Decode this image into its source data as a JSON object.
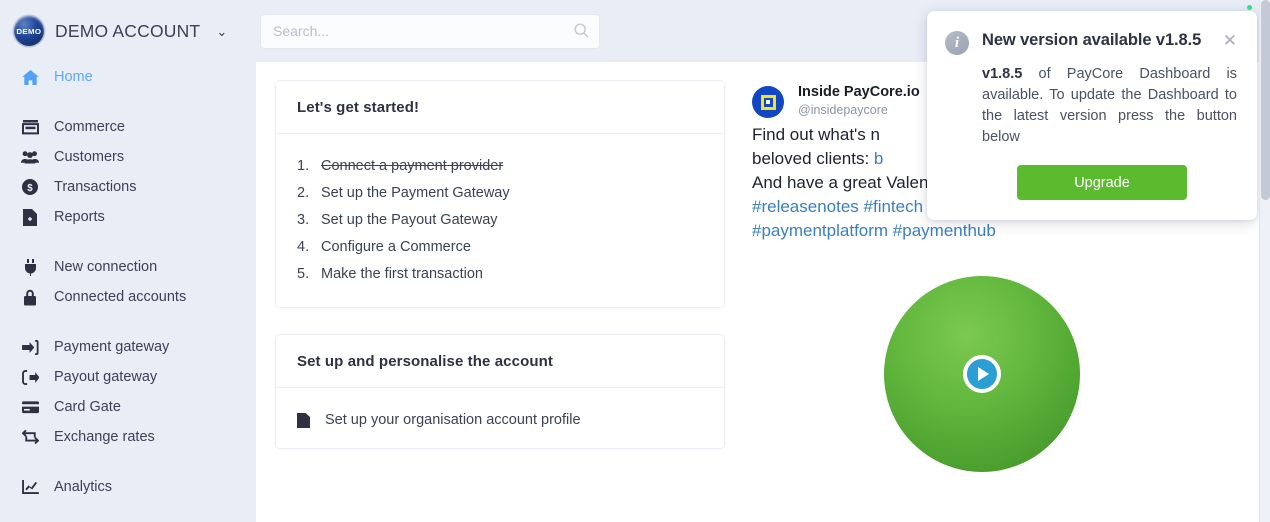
{
  "sidebar": {
    "brand": {
      "logo_text": "DEMO",
      "name": "DEMO ACCOUNT",
      "caret": "⌄"
    },
    "groups": [
      {
        "items": [
          {
            "label": "Home",
            "icon": "home-icon",
            "active": true
          }
        ]
      },
      {
        "items": [
          {
            "label": "Commerce",
            "icon": "store-icon",
            "active": false
          },
          {
            "label": "Customers",
            "icon": "users-icon",
            "active": false
          },
          {
            "label": "Transactions",
            "icon": "dollar-circle-icon",
            "active": false
          },
          {
            "label": "Reports",
            "icon": "report-file-icon",
            "active": false
          }
        ]
      },
      {
        "items": [
          {
            "label": "New connection",
            "icon": "plug-icon",
            "active": false
          },
          {
            "label": "Connected accounts",
            "icon": "lock-icon",
            "active": false
          }
        ]
      },
      {
        "items": [
          {
            "label": "Payment gateway",
            "icon": "sign-in-icon",
            "active": false
          },
          {
            "label": "Payout gateway",
            "icon": "sign-out-icon",
            "active": false
          },
          {
            "label": "Card Gate",
            "icon": "credit-card-icon",
            "active": false
          },
          {
            "label": "Exchange rates",
            "icon": "exchange-icon",
            "active": false
          }
        ]
      },
      {
        "items": [
          {
            "label": "Analytics",
            "icon": "chart-line-icon",
            "active": false
          }
        ]
      }
    ]
  },
  "topbar": {
    "search": {
      "value": "",
      "placeholder": "Search...",
      "icon": "search-icon"
    }
  },
  "get_started_card": {
    "title": "Let's get started!",
    "steps": [
      {
        "text": "Connect a payment provider",
        "done": true
      },
      {
        "text": "Set up the Payment Gateway",
        "done": false
      },
      {
        "text": "Set up the Payout Gateway",
        "done": false
      },
      {
        "text": "Configure a Commerce",
        "done": false
      },
      {
        "text": "Make the first transaction",
        "done": false
      }
    ]
  },
  "account_card": {
    "title": "Set up and personalise the account",
    "first_row": {
      "icon": "profile-file-icon",
      "label": "Set up your organisation account profile"
    }
  },
  "feed": {
    "author_name": "Inside PayCore.io",
    "author_handle": "@insidepaycore",
    "avatar_icon": "paycore-avatar-icon",
    "text_line1": "Find out what's n",
    "text_line2_prefix": "beloved clients: ",
    "text_line2_link": "b",
    "text_line3": "And have a great Valentine's weekend!",
    "hashtags_line1": "#releasenotes #fintech #payments",
    "hashtags_line2": "#paymentplatform #paymenthub",
    "media": {
      "type": "video-thumbnail",
      "play_icon": "play-icon"
    }
  },
  "toast": {
    "icon": "info-icon",
    "title": "New version available v1.8.5",
    "close_icon": "close-icon",
    "message_version": "v1.8.5",
    "message_rest": " of PayCore Dashboard is available. To update the Dashboard to the latest version press the button below",
    "button_label": "Upgrade",
    "accent_color": "#5cba2e"
  },
  "colors": {
    "sidebar_bg": "#e9edf6",
    "accent_blue": "#51a2f5",
    "link_blue": "#3a7fbf",
    "text_dark": "#2e3243",
    "upgrade_green": "#5cba2e"
  }
}
